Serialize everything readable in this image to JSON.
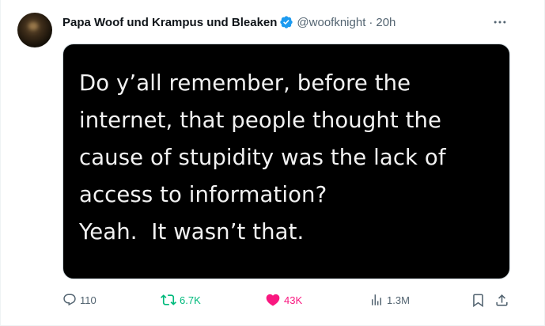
{
  "tweet": {
    "author": {
      "display_name": "Papa Woof und Krampus und Bleaken",
      "handle": "@woofknight",
      "separator": "·",
      "time": "20h",
      "verified": true
    },
    "more_icon": "more-dots-icon",
    "image_text": [
      "Do y’all remember, before the",
      "internet, that people thought the",
      "cause of stupidity was the lack of",
      "access to information?",
      "Yeah.  It wasn’t that."
    ],
    "actions": {
      "replies": "110",
      "reposts": "6.7K",
      "likes": "43K",
      "views": "1.3M"
    },
    "colors": {
      "verified": "#1d9bf0",
      "repost_active": "#00ba7c",
      "like_active": "#f91880",
      "muted": "#536471"
    }
  }
}
